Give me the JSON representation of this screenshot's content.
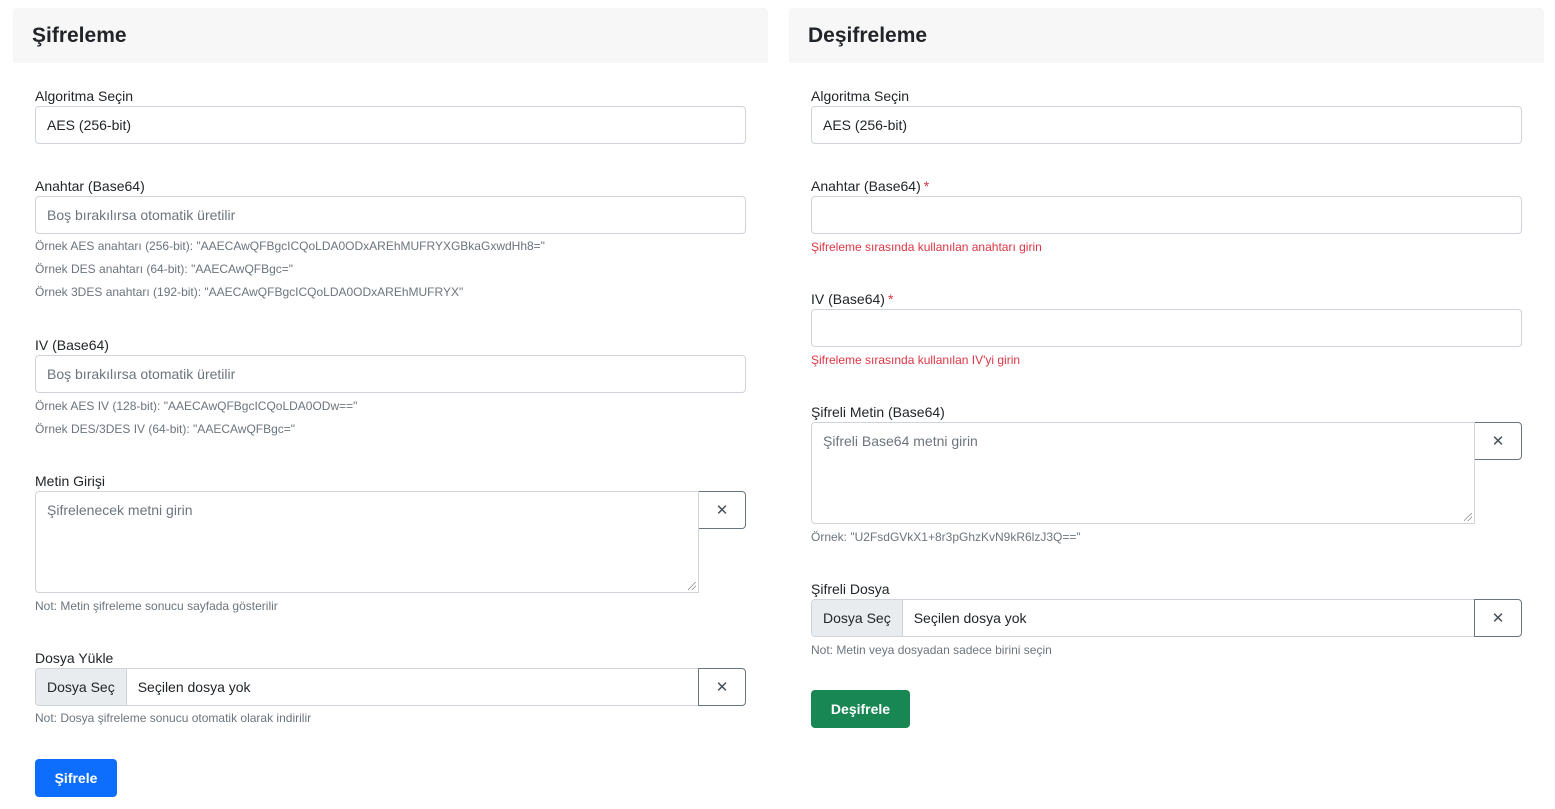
{
  "encrypt": {
    "title": "Şifreleme",
    "algorithm": {
      "label": "Algoritma Seçin",
      "value": "AES (256-bit)"
    },
    "key": {
      "label": "Anahtar (Base64)",
      "placeholder": "Boş bırakılırsa otomatik üretilir",
      "hints": [
        "Örnek AES anahtarı (256-bit): \"AAECAwQFBgcICQoLDA0ODxAREhMUFRYXGBkaGxwdHh8=\"",
        "Örnek DES anahtarı (64-bit): \"AAECAwQFBgc=\"",
        "Örnek 3DES anahtarı (192-bit): \"AAECAwQFBgcICQoLDA0ODxAREhMUFRYX\""
      ]
    },
    "iv": {
      "label": "IV (Base64)",
      "placeholder": "Boş bırakılırsa otomatik üretilir",
      "hints": [
        "Örnek AES IV (128-bit): \"AAECAwQFBgcICQoLDA0ODw==\"",
        "Örnek DES/3DES IV (64-bit): \"AAECAwQFBgc=\""
      ]
    },
    "text": {
      "label": "Metin Girişi",
      "placeholder": "Şifrelenecek metni girin",
      "clear": "✕",
      "note": "Not: Metin şifreleme sonucu sayfada gösterilir"
    },
    "file": {
      "label": "Dosya Yükle",
      "button": "Dosya Seç",
      "status": "Seçilen dosya yok",
      "clear": "✕",
      "note": "Not: Dosya şifreleme sonucu otomatik olarak indirilir"
    },
    "submit": "Şifrele"
  },
  "decrypt": {
    "title": "Deşifreleme",
    "algorithm": {
      "label": "Algoritma Seçin",
      "value": "AES (256-bit)"
    },
    "key": {
      "label": "Anahtar (Base64)",
      "required": "*",
      "placeholder": "",
      "error": "Şifreleme sırasında kullanılan anahtarı girin"
    },
    "iv": {
      "label": "IV (Base64)",
      "required": "*",
      "placeholder": "",
      "error": "Şifreleme sırasında kullanılan IV'yi girin"
    },
    "cipher": {
      "label": "Şifreli Metin (Base64)",
      "placeholder": "Şifreli Base64 metni girin",
      "clear": "✕",
      "example": "Örnek: \"U2FsdGVkX1+8r3pGhzKvN9kR6lzJ3Q==\""
    },
    "file": {
      "label": "Şifreli Dosya",
      "button": "Dosya Seç",
      "status": "Seçilen dosya yok",
      "clear": "✕",
      "note": "Not: Metin veya dosyadan sadece birini seçin"
    },
    "submit": "Deşifrele"
  }
}
